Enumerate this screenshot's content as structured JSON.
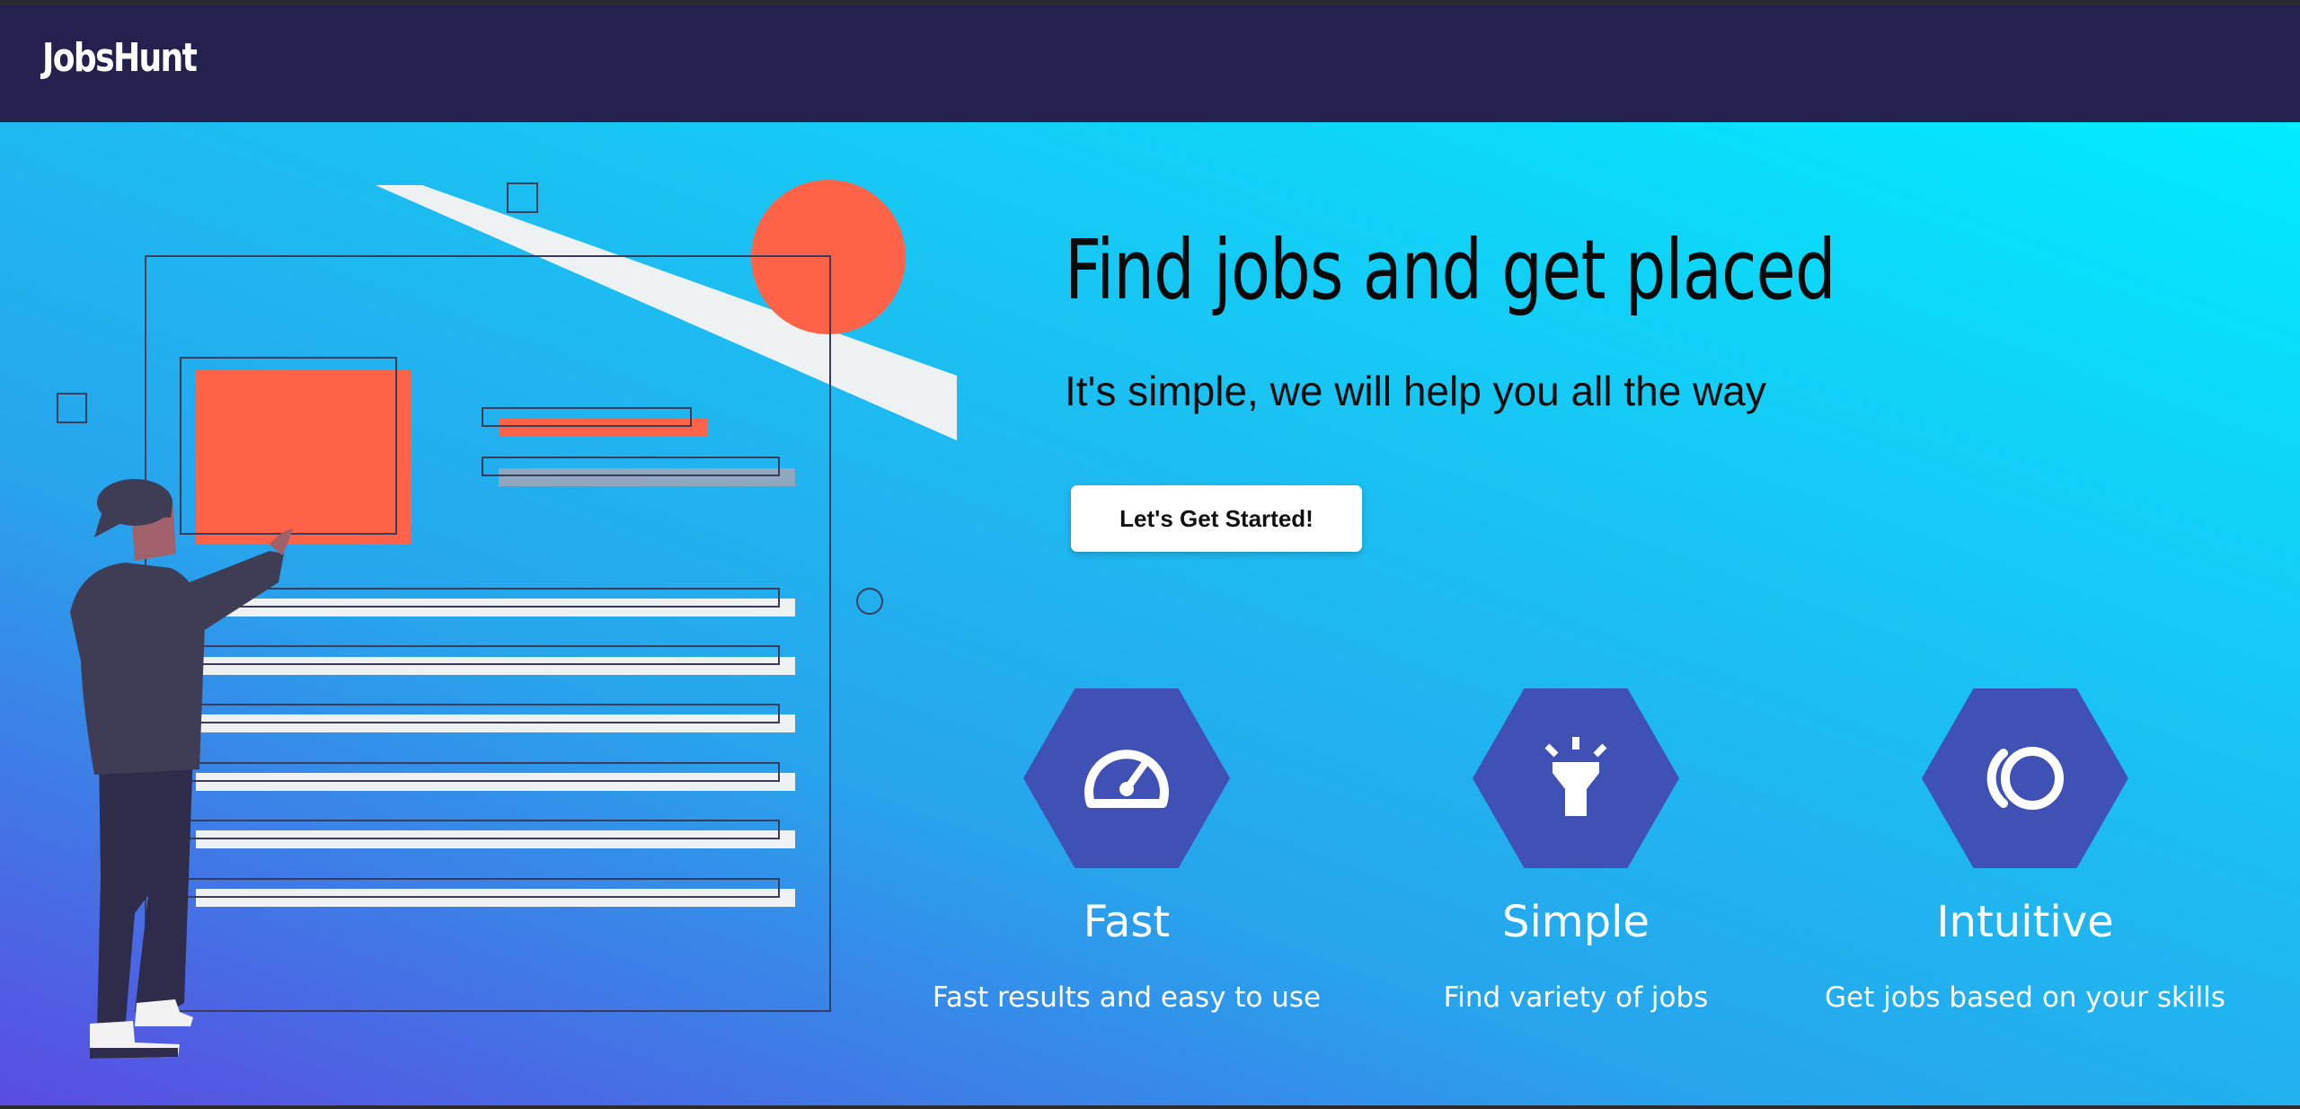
{
  "navbar": {
    "brand": "JobsHunt"
  },
  "hero": {
    "headline": "Find jobs and get placed",
    "subheadline": "It's simple, we will help you all the way",
    "cta_label": "Let's Get Started!"
  },
  "features": [
    {
      "icon": "speedometer-icon",
      "title": "Fast",
      "description": "Fast results and easy to use"
    },
    {
      "icon": "lightbulb-icon",
      "title": "Simple",
      "description": "Find variety of jobs"
    },
    {
      "icon": "circles-icon",
      "title": "Intuitive",
      "description": "Get jobs based on your skills"
    }
  ],
  "colors": {
    "navbar_bg": "#24214e",
    "gradient_top": "#00ecff",
    "gradient_bottom": "#5a4ce1",
    "hexagon": "#3f51b5",
    "accent": "#ff6347",
    "button_bg": "#ffffff"
  }
}
